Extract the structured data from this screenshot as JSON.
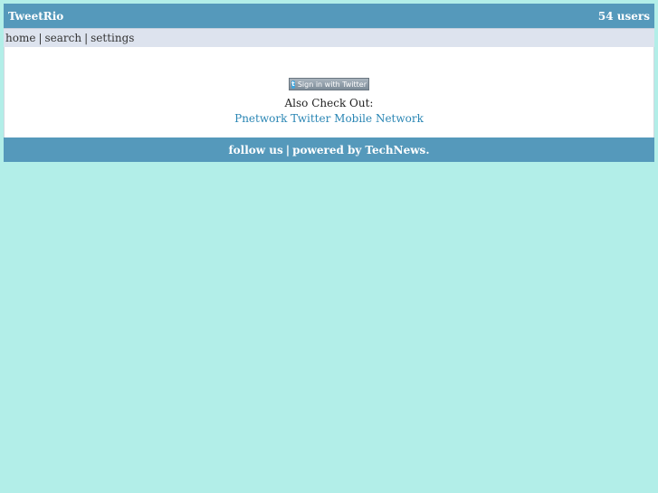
{
  "header": {
    "site_name": "TweetRio",
    "user_count": "54 users"
  },
  "nav": {
    "items": [
      {
        "label": "home"
      },
      {
        "label": "search"
      },
      {
        "label": "settings"
      }
    ],
    "separator": "|"
  },
  "main": {
    "signin_button_label": "Sign in with Twitter",
    "also_check_out": "Also Check Out:",
    "link_label": "Pnetwork Twitter Mobile Network"
  },
  "footer": {
    "follow_label": "follow us",
    "separator": "|",
    "powered_by_text": "powered by",
    "powered_by_link": "TechNews",
    "end_punct": "."
  },
  "colors": {
    "page_background": "#b2eee8",
    "bar_background": "#5599bb",
    "nav_background": "#dde3ee",
    "link_color": "#2a86b4"
  },
  "icons": {
    "signin": "twitter-bird-icon"
  }
}
